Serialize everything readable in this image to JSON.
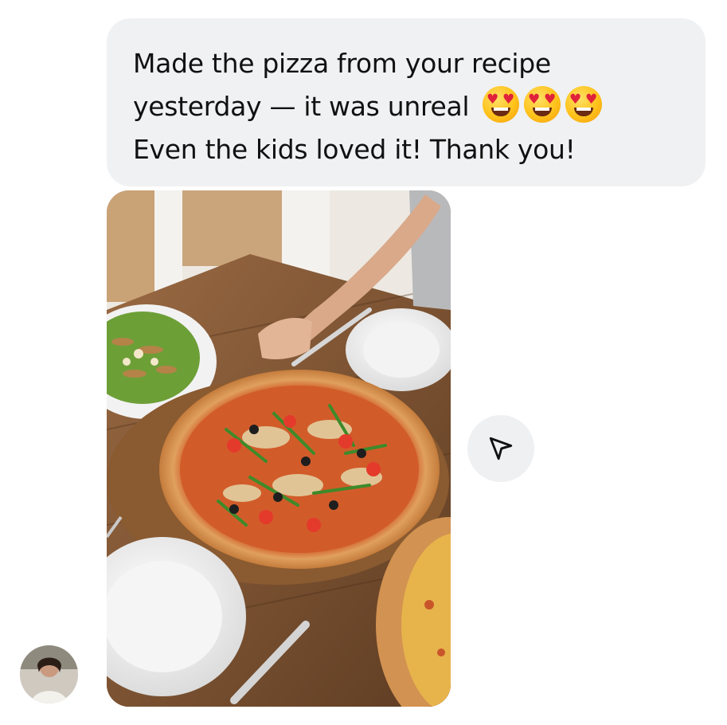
{
  "message": {
    "lines": [
      "Made the pizza from your recipe",
      "yesterday — it was unreal",
      "Even the kids loved it! Thank you!"
    ],
    "emojis": [
      "heart-eyes-emoji",
      "heart-eyes-emoji",
      "heart-eyes-emoji"
    ]
  },
  "attachment": {
    "type": "photo",
    "subject": "pizza on wooden table"
  },
  "actions": {
    "share_icon": "send-icon"
  },
  "sender": {
    "avatar_icon": "avatar"
  },
  "colors": {
    "bubble": "#f0f1f3",
    "text": "#111111",
    "share_button": "#eef0f2"
  }
}
